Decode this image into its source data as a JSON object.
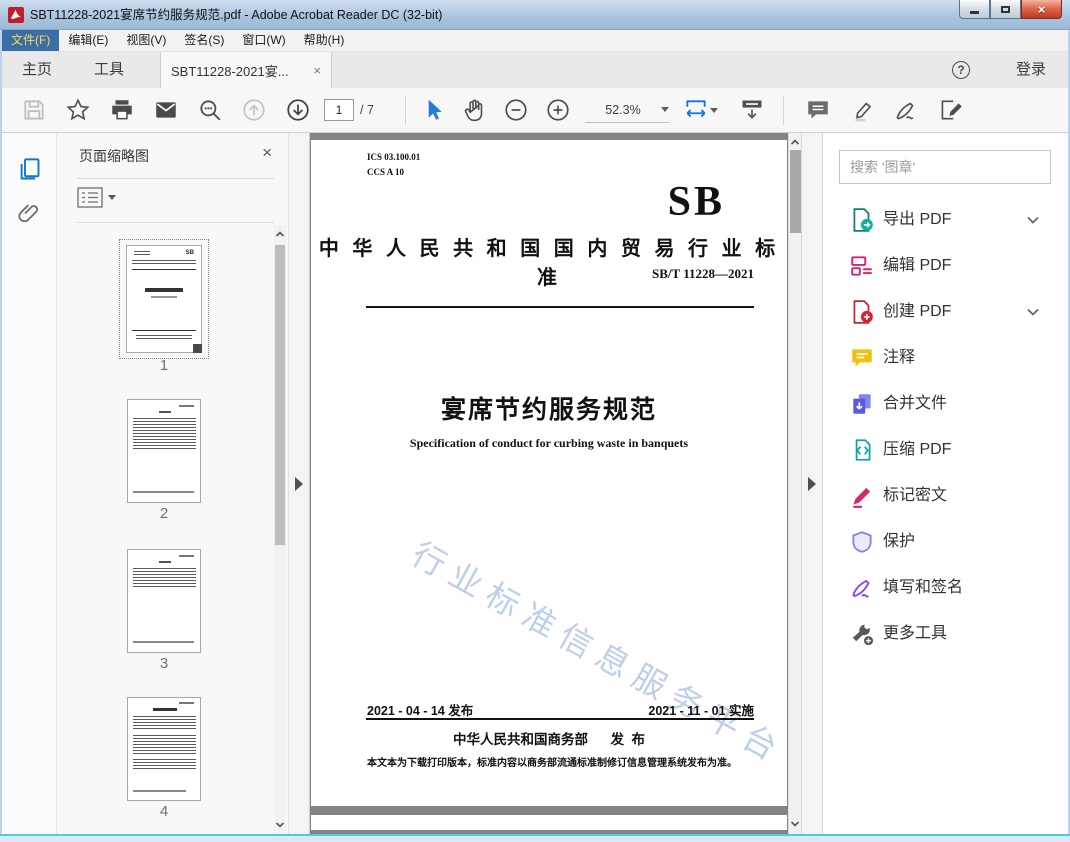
{
  "window": {
    "title": "SBT11228-2021宴席节约服务规范.pdf - Adobe Acrobat Reader DC (32-bit)"
  },
  "menu": {
    "items": [
      "文件(F)",
      "编辑(E)",
      "视图(V)",
      "签名(S)",
      "窗口(W)",
      "帮助(H)"
    ]
  },
  "tabs": {
    "home": "主页",
    "tools": "工具",
    "doc": "SBT11228-2021宴...",
    "doc_close": "×",
    "help": "?",
    "sign_in": "登录"
  },
  "toolbar": {
    "page_current": "1",
    "page_total": "/ 7",
    "zoom_level": "52.3%"
  },
  "thumbnails": {
    "panel_title": "页面缩略图",
    "close": "×",
    "pages": [
      "1",
      "2",
      "3",
      "4"
    ]
  },
  "document": {
    "ics": "ICS  03.100.01",
    "ccs": "CCS  A 10",
    "logo": "SB",
    "standard_line": "中 华 人 民 共 和 国 国 内 贸 易 行 业 标 准",
    "std_number": "SB/T 11228—2021",
    "title": "宴席节约服务规范",
    "subtitle": "Specification of conduct for curbing waste in banquets",
    "watermark": "行业标准信息服务平台",
    "date_issue": "2021 - 04 - 14 发布",
    "date_impl": "2021 - 11 - 01 实施",
    "publisher": "中华人民共和国商务部      发  布",
    "footnote": "本文本为下载打印版本，标准内容以商务部流通标准制修订信息管理系统发布为准。"
  },
  "right_panel": {
    "search_placeholder": "搜索 '图章'",
    "tools": [
      {
        "label": "导出 PDF",
        "icon": "export-pdf-icon",
        "chevron": true
      },
      {
        "label": "编辑 PDF",
        "icon": "edit-pdf-icon",
        "chevron": false
      },
      {
        "label": "创建 PDF",
        "icon": "create-pdf-icon",
        "chevron": true
      },
      {
        "label": "注释",
        "icon": "comment-icon",
        "chevron": false
      },
      {
        "label": "合并文件",
        "icon": "combine-files-icon",
        "chevron": false
      },
      {
        "label": "压缩 PDF",
        "icon": "compress-pdf-icon",
        "chevron": false
      },
      {
        "label": "标记密文",
        "icon": "redact-icon",
        "chevron": false
      },
      {
        "label": "保护",
        "icon": "protect-icon",
        "chevron": false
      },
      {
        "label": "填写和签名",
        "icon": "fill-sign-icon",
        "chevron": false
      },
      {
        "label": "更多工具",
        "icon": "more-tools-icon",
        "chevron": false
      }
    ]
  }
}
